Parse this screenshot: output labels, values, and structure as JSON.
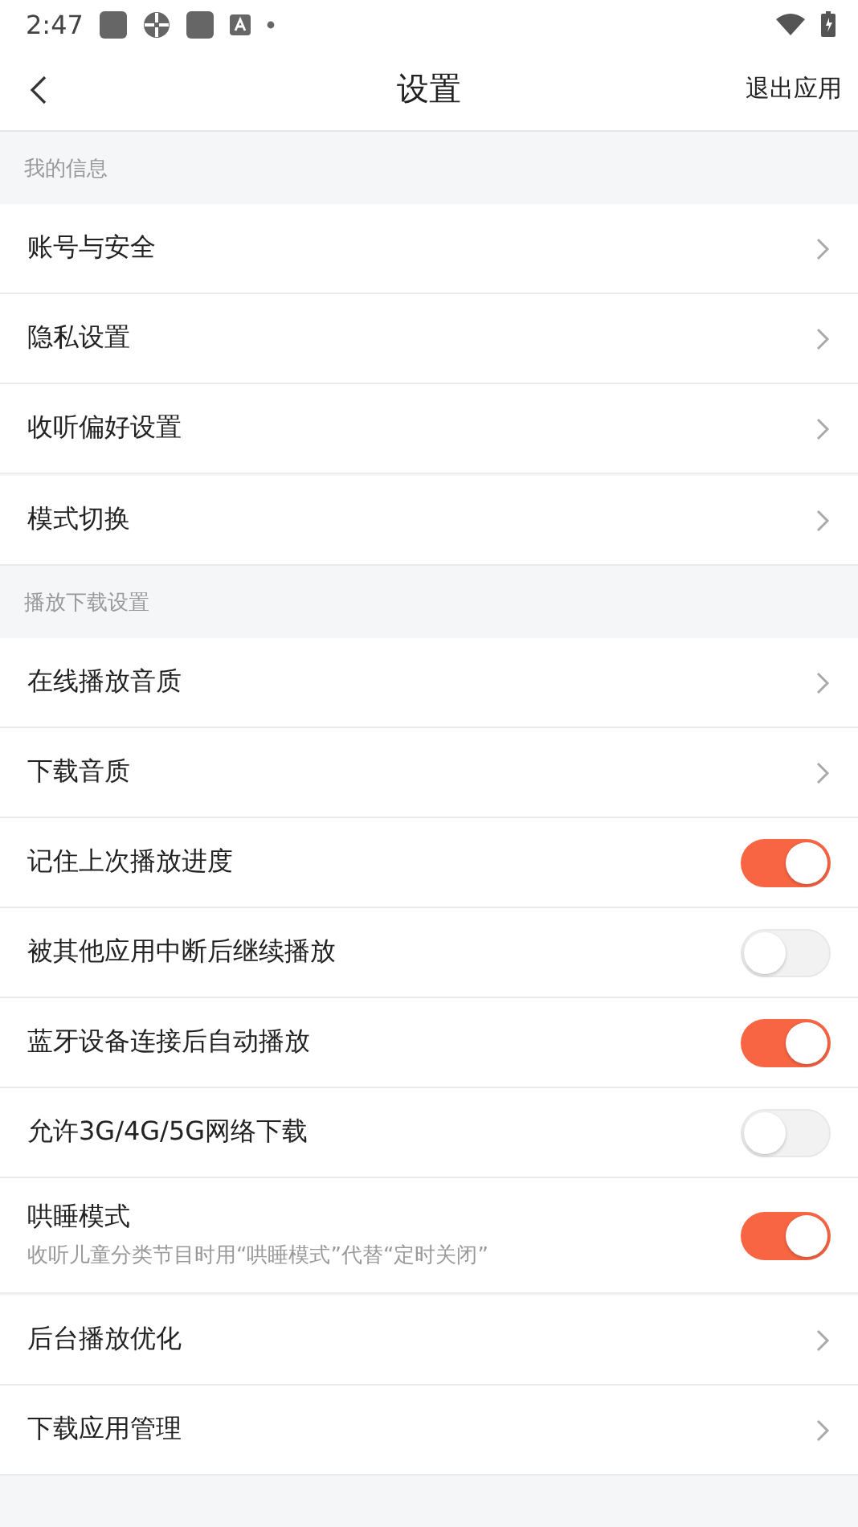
{
  "status_bar": {
    "time": "2:47"
  },
  "header": {
    "title": "设置",
    "action": "退出应用"
  },
  "sections": [
    {
      "title": "我的信息",
      "items": [
        {
          "kind": "chevron",
          "label": "账号与安全"
        },
        {
          "kind": "chevron",
          "label": "隐私设置"
        },
        {
          "kind": "chevron",
          "label": "收听偏好设置"
        }
      ]
    },
    {
      "items": [
        {
          "kind": "chevron",
          "label": "模式切换"
        }
      ]
    },
    {
      "title": "播放下载设置",
      "items": [
        {
          "kind": "chevron",
          "label": "在线播放音质"
        },
        {
          "kind": "chevron",
          "label": "下载音质"
        },
        {
          "kind": "toggle",
          "label": "记住上次播放进度",
          "on": true
        },
        {
          "kind": "toggle",
          "label": "被其他应用中断后继续播放",
          "on": false
        },
        {
          "kind": "toggle",
          "label": "蓝牙设备连接后自动播放",
          "on": true
        },
        {
          "kind": "toggle",
          "label": "允许3G/4G/5G网络下载",
          "on": false
        },
        {
          "kind": "toggle",
          "label": "哄睡模式",
          "subtitle": "收听儿童分类节目时用“哄睡模式”代替“定时关闭”",
          "on": true
        }
      ]
    },
    {
      "items": [
        {
          "kind": "chevron",
          "label": "后台播放优化"
        },
        {
          "kind": "chevron",
          "label": "下载应用管理"
        }
      ]
    }
  ]
}
